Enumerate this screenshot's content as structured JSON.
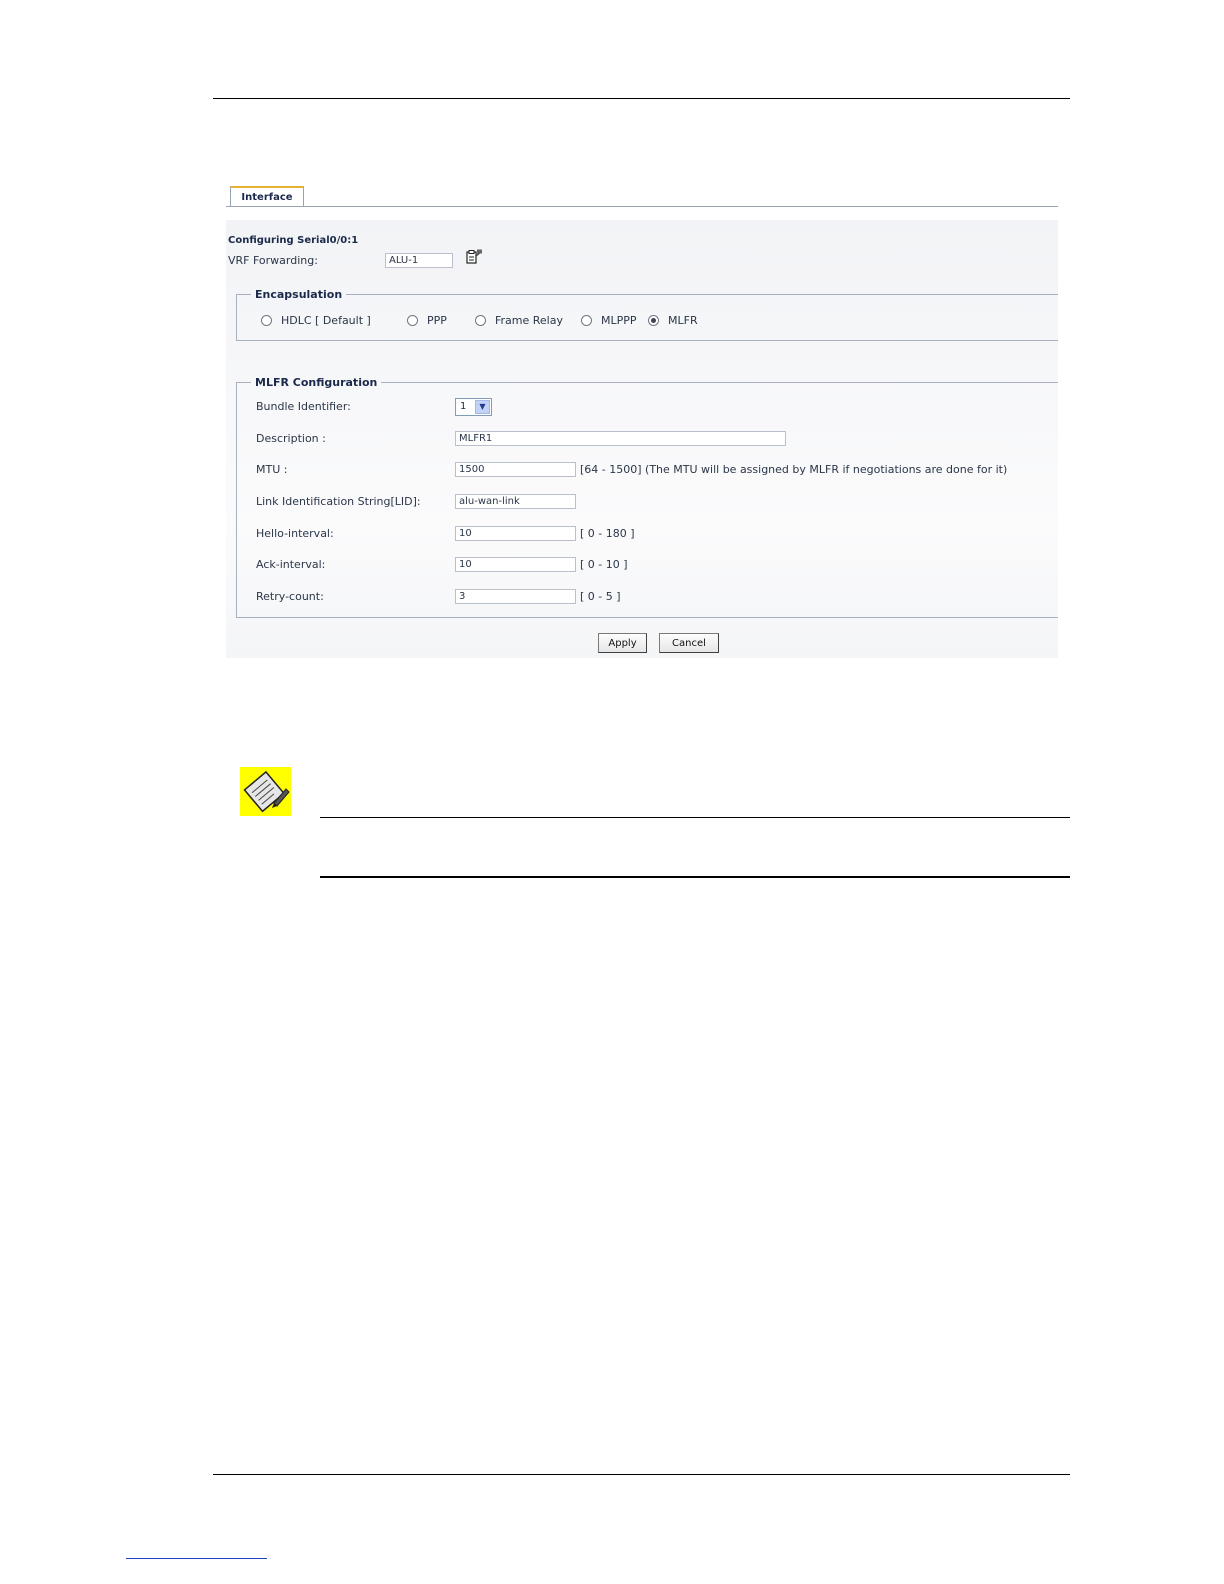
{
  "tab": {
    "label": "Interface"
  },
  "header": {
    "configuring": "Configuring  Serial0/0:1"
  },
  "vrf": {
    "label": "VRF Forwarding:",
    "value": "ALU-1",
    "icon": "clipboard-edit-icon"
  },
  "encapsulation": {
    "legend": "Encapsulation",
    "options": [
      {
        "label": "HDLC [ Default ]",
        "checked": false
      },
      {
        "label": "PPP",
        "checked": false
      },
      {
        "label": "Frame Relay",
        "checked": false
      },
      {
        "label": "MLPPP",
        "checked": false
      },
      {
        "label": "MLFR",
        "checked": true
      }
    ]
  },
  "mlfr": {
    "legend": "MLFR Configuration",
    "bundle": {
      "label": "Bundle Identifier:",
      "value": "1"
    },
    "description": {
      "label": "Description :",
      "value": "MLFR1"
    },
    "mtu": {
      "label": "MTU :",
      "value": "1500",
      "hint": "[64 - 1500]   (The MTU will be assigned by MLFR if negotiations are done for it)"
    },
    "lid": {
      "label": "Link Identification String[LID]:",
      "value": "alu-wan-link"
    },
    "hello": {
      "label": "Hello-interval:",
      "value": "10",
      "hint": "[ 0 - 180 ]"
    },
    "ack": {
      "label": "Ack-interval:",
      "value": "10",
      "hint": "[ 0 - 10 ]"
    },
    "retry": {
      "label": "Retry-count:",
      "value": "3",
      "hint": "[ 0 - 5 ]"
    }
  },
  "buttons": {
    "apply": "Apply",
    "cancel": "Cancel"
  },
  "note": {
    "icon": "note-pencil-icon",
    "background": "#ffff00"
  }
}
